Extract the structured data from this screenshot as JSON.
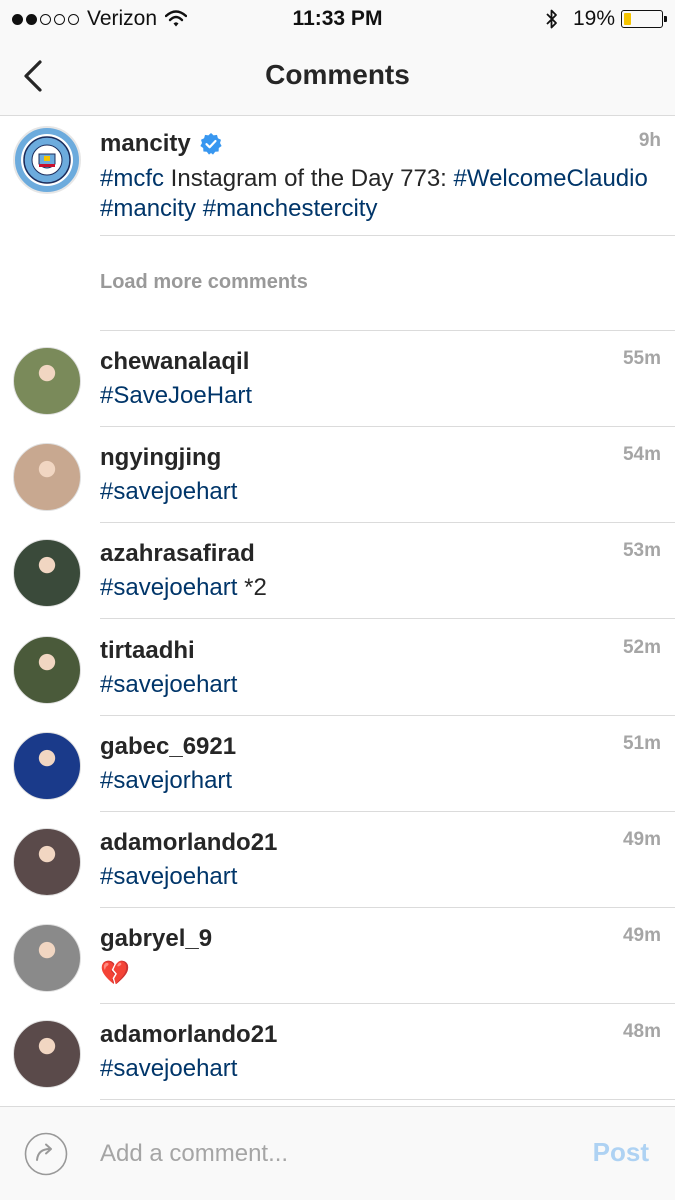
{
  "status_bar": {
    "carrier": "Verizon",
    "time": "11:33 PM",
    "battery_percent": "19%",
    "battery_level": 0.19,
    "signal_bars": 2
  },
  "header": {
    "title": "Comments"
  },
  "caption": {
    "username": "mancity",
    "verified": true,
    "text_parts": [
      {
        "type": "tag",
        "text": "#mcfc"
      },
      {
        "type": "text",
        "text": " Instagram of the Day 773: "
      },
      {
        "type": "tag",
        "text": "#WelcomeClaudio"
      },
      {
        "type": "text",
        "text": " "
      },
      {
        "type": "tag",
        "text": "#mancity"
      },
      {
        "type": "text",
        "text": " "
      },
      {
        "type": "tag",
        "text": "#manchestercity"
      }
    ],
    "time": "9h"
  },
  "load_more": "Load more comments",
  "comments": [
    {
      "username": "chewanalaqil",
      "tag": "#SaveJoeHart",
      "suffix": "",
      "time": "55m",
      "avatar_color": "#7a8a5a"
    },
    {
      "username": "ngyingjing",
      "tag": "#savejoehart",
      "suffix": "",
      "time": "54m",
      "avatar_color": "#c8a890"
    },
    {
      "username": "azahrasafirad",
      "tag": "#savejoehart",
      "suffix": " *2",
      "time": "53m",
      "avatar_color": "#3a4a3a"
    },
    {
      "username": "tirtaadhi",
      "tag": "#savejoehart",
      "suffix": "",
      "time": "52m",
      "avatar_color": "#4a5a3a"
    },
    {
      "username": "gabec_6921",
      "tag": "#savejorhart",
      "suffix": "",
      "time": "51m",
      "avatar_color": "#1a3a8a"
    },
    {
      "username": "adamorlando21",
      "tag": "#savejoehart",
      "suffix": "",
      "time": "49m",
      "avatar_color": "#5a4a4a"
    },
    {
      "username": "gabryel_9",
      "tag": "",
      "suffix": "💔",
      "time": "49m",
      "avatar_color": "#8a8a8a"
    },
    {
      "username": "adamorlando21",
      "tag": "#savejoehart",
      "suffix": "",
      "time": "48m",
      "avatar_color": "#5a4a4a"
    }
  ],
  "composer": {
    "placeholder": "Add a comment...",
    "post_label": "Post"
  },
  "icons": {
    "back": "chevron-left-icon",
    "verified": "verified-badge-icon",
    "reply": "reply-arrow-icon",
    "wifi": "wifi-icon",
    "bluetooth": "bluetooth-icon",
    "battery": "battery-icon"
  },
  "colors": {
    "hashtag": "#003569",
    "verified": "#3897f0",
    "post_disabled": "#aed2f3",
    "battery_fill": "#f5c400"
  }
}
